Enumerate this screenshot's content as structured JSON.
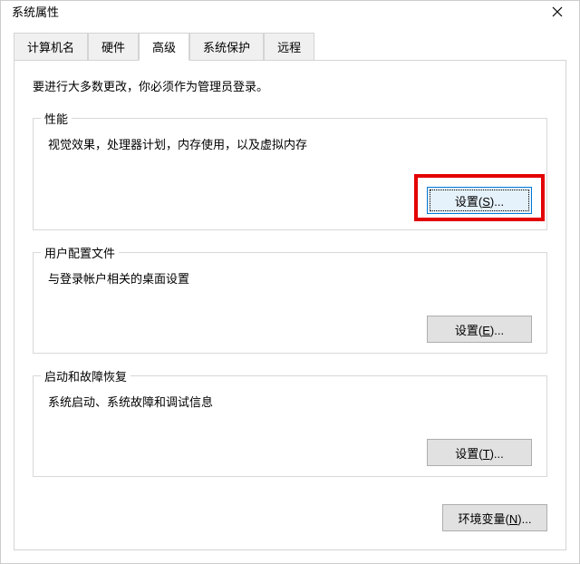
{
  "window": {
    "title": "系统属性"
  },
  "tabs": {
    "computer_name": "计算机名",
    "hardware": "硬件",
    "advanced": "高级",
    "system_protection": "系统保护",
    "remote": "远程"
  },
  "notice": "要进行大多数更改，你必须作为管理员登录。",
  "groups": {
    "performance": {
      "title": "性能",
      "description": "视觉效果，处理器计划，内存使用，以及虚拟内存",
      "button_prefix": "设置(",
      "button_key": "S",
      "button_suffix": ")..."
    },
    "user_profiles": {
      "title": "用户配置文件",
      "description": "与登录帐户相关的桌面设置",
      "button_prefix": "设置(",
      "button_key": "E",
      "button_suffix": ")..."
    },
    "startup_recovery": {
      "title": "启动和故障恢复",
      "description": "系统启动、系统故障和调试信息",
      "button_prefix": "设置(",
      "button_key": "T",
      "button_suffix": ")..."
    }
  },
  "env_button": {
    "prefix": "环境变量(",
    "key": "N",
    "suffix": ")..."
  }
}
